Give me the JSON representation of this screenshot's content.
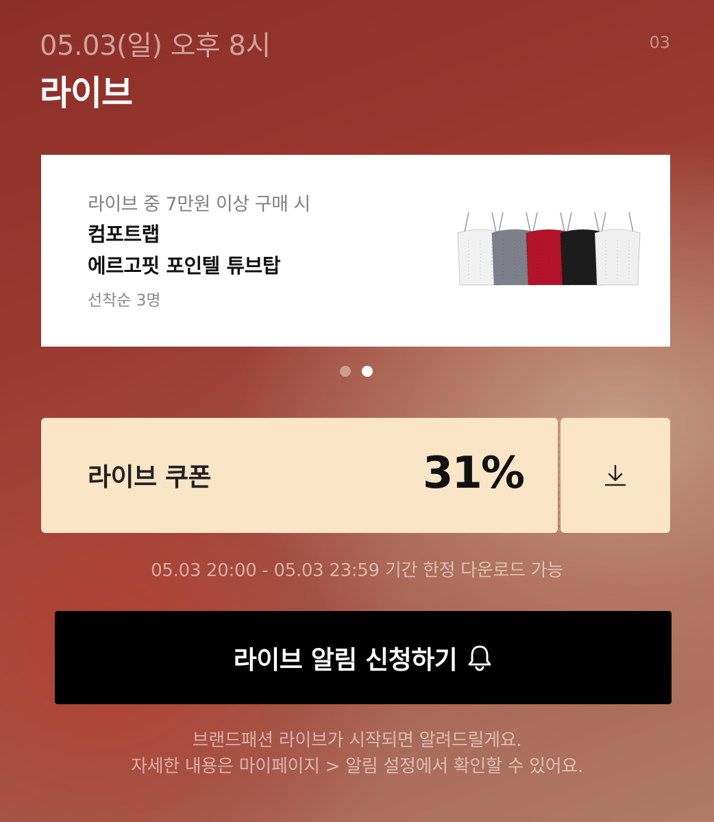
{
  "header": {
    "date": "05.03(일) 오후 8시",
    "page_number": "03",
    "title": "라이브"
  },
  "promo": {
    "condition": "라이브 중 7만원 이상 구매 시",
    "product_line1": "컴포트랩",
    "product_line2": "에르고핏 포인텔 튜브탑",
    "limit": "선착순 3명",
    "image_colors": [
      "#f2f2f2",
      "#7d8088",
      "#b3122b",
      "#1c1c1c",
      "#efefef"
    ]
  },
  "carousel": {
    "total": 2,
    "active_index": 1
  },
  "coupon": {
    "label": "라이브 쿠폰",
    "value": "31%",
    "download_icon": "download-icon",
    "period": "05.03 20:00 - 05.03 23:59 기간 한정 다운로드 가능"
  },
  "notify_button": {
    "label": "라이브 알림 신청하기",
    "icon": "bell-icon"
  },
  "footer": {
    "line1": "브랜드패션 라이브가 시작되면 알려드릴게요.",
    "line2": "자세한 내용은 마이페이지 > 알림 설정에서 확인할 수 있어요."
  },
  "colors": {
    "coupon_bg": "#fbe5c7",
    "button_bg": "#000000",
    "card_bg": "#ffffff"
  }
}
